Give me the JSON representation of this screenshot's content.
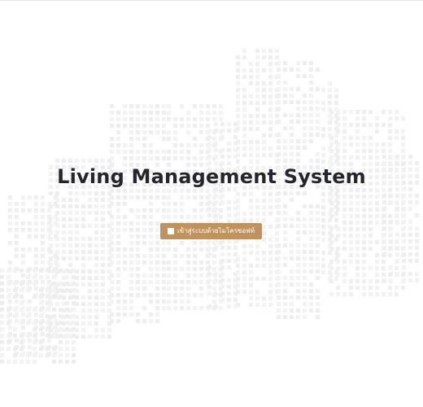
{
  "hero": {
    "title": "Living Management System"
  },
  "login_button": {
    "label": "เข้าสู่ระบบด้วยไมโครซอฟท์",
    "icon": "microsoft-icon",
    "color": "#c0925c"
  },
  "colors": {
    "title": "#25262d",
    "background": "#ffffff",
    "building_pattern": "#eeeeee"
  }
}
